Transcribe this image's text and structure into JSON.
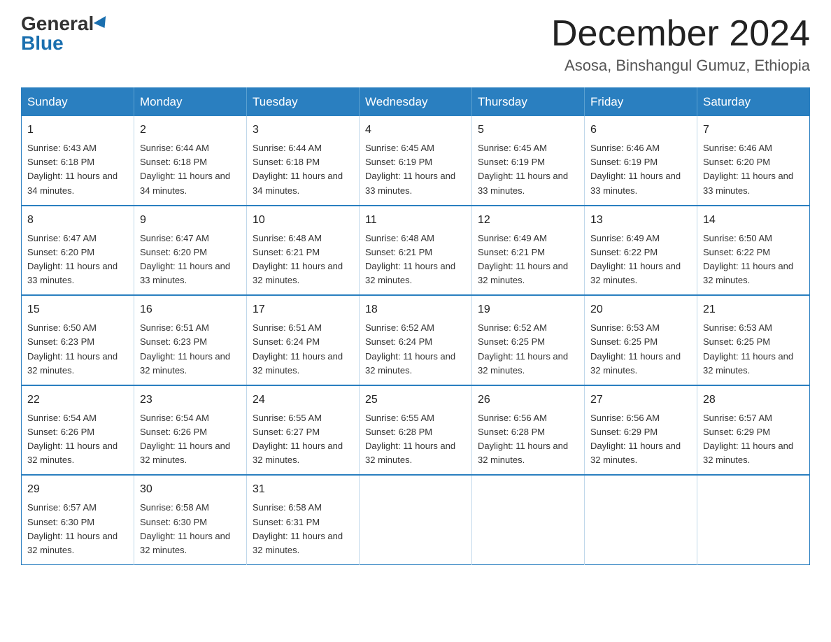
{
  "header": {
    "logo_general": "General",
    "logo_blue": "Blue",
    "month_year": "December 2024",
    "location": "Asosa, Binshangul Gumuz, Ethiopia"
  },
  "weekdays": [
    "Sunday",
    "Monday",
    "Tuesday",
    "Wednesday",
    "Thursday",
    "Friday",
    "Saturday"
  ],
  "weeks": [
    [
      {
        "day": "1",
        "sunrise": "6:43 AM",
        "sunset": "6:18 PM",
        "daylight": "11 hours and 34 minutes."
      },
      {
        "day": "2",
        "sunrise": "6:44 AM",
        "sunset": "6:18 PM",
        "daylight": "11 hours and 34 minutes."
      },
      {
        "day": "3",
        "sunrise": "6:44 AM",
        "sunset": "6:18 PM",
        "daylight": "11 hours and 34 minutes."
      },
      {
        "day": "4",
        "sunrise": "6:45 AM",
        "sunset": "6:19 PM",
        "daylight": "11 hours and 33 minutes."
      },
      {
        "day": "5",
        "sunrise": "6:45 AM",
        "sunset": "6:19 PM",
        "daylight": "11 hours and 33 minutes."
      },
      {
        "day": "6",
        "sunrise": "6:46 AM",
        "sunset": "6:19 PM",
        "daylight": "11 hours and 33 minutes."
      },
      {
        "day": "7",
        "sunrise": "6:46 AM",
        "sunset": "6:20 PM",
        "daylight": "11 hours and 33 minutes."
      }
    ],
    [
      {
        "day": "8",
        "sunrise": "6:47 AM",
        "sunset": "6:20 PM",
        "daylight": "11 hours and 33 minutes."
      },
      {
        "day": "9",
        "sunrise": "6:47 AM",
        "sunset": "6:20 PM",
        "daylight": "11 hours and 33 minutes."
      },
      {
        "day": "10",
        "sunrise": "6:48 AM",
        "sunset": "6:21 PM",
        "daylight": "11 hours and 32 minutes."
      },
      {
        "day": "11",
        "sunrise": "6:48 AM",
        "sunset": "6:21 PM",
        "daylight": "11 hours and 32 minutes."
      },
      {
        "day": "12",
        "sunrise": "6:49 AM",
        "sunset": "6:21 PM",
        "daylight": "11 hours and 32 minutes."
      },
      {
        "day": "13",
        "sunrise": "6:49 AM",
        "sunset": "6:22 PM",
        "daylight": "11 hours and 32 minutes."
      },
      {
        "day": "14",
        "sunrise": "6:50 AM",
        "sunset": "6:22 PM",
        "daylight": "11 hours and 32 minutes."
      }
    ],
    [
      {
        "day": "15",
        "sunrise": "6:50 AM",
        "sunset": "6:23 PM",
        "daylight": "11 hours and 32 minutes."
      },
      {
        "day": "16",
        "sunrise": "6:51 AM",
        "sunset": "6:23 PM",
        "daylight": "11 hours and 32 minutes."
      },
      {
        "day": "17",
        "sunrise": "6:51 AM",
        "sunset": "6:24 PM",
        "daylight": "11 hours and 32 minutes."
      },
      {
        "day": "18",
        "sunrise": "6:52 AM",
        "sunset": "6:24 PM",
        "daylight": "11 hours and 32 minutes."
      },
      {
        "day": "19",
        "sunrise": "6:52 AM",
        "sunset": "6:25 PM",
        "daylight": "11 hours and 32 minutes."
      },
      {
        "day": "20",
        "sunrise": "6:53 AM",
        "sunset": "6:25 PM",
        "daylight": "11 hours and 32 minutes."
      },
      {
        "day": "21",
        "sunrise": "6:53 AM",
        "sunset": "6:25 PM",
        "daylight": "11 hours and 32 minutes."
      }
    ],
    [
      {
        "day": "22",
        "sunrise": "6:54 AM",
        "sunset": "6:26 PM",
        "daylight": "11 hours and 32 minutes."
      },
      {
        "day": "23",
        "sunrise": "6:54 AM",
        "sunset": "6:26 PM",
        "daylight": "11 hours and 32 minutes."
      },
      {
        "day": "24",
        "sunrise": "6:55 AM",
        "sunset": "6:27 PM",
        "daylight": "11 hours and 32 minutes."
      },
      {
        "day": "25",
        "sunrise": "6:55 AM",
        "sunset": "6:28 PM",
        "daylight": "11 hours and 32 minutes."
      },
      {
        "day": "26",
        "sunrise": "6:56 AM",
        "sunset": "6:28 PM",
        "daylight": "11 hours and 32 minutes."
      },
      {
        "day": "27",
        "sunrise": "6:56 AM",
        "sunset": "6:29 PM",
        "daylight": "11 hours and 32 minutes."
      },
      {
        "day": "28",
        "sunrise": "6:57 AM",
        "sunset": "6:29 PM",
        "daylight": "11 hours and 32 minutes."
      }
    ],
    [
      {
        "day": "29",
        "sunrise": "6:57 AM",
        "sunset": "6:30 PM",
        "daylight": "11 hours and 32 minutes."
      },
      {
        "day": "30",
        "sunrise": "6:58 AM",
        "sunset": "6:30 PM",
        "daylight": "11 hours and 32 minutes."
      },
      {
        "day": "31",
        "sunrise": "6:58 AM",
        "sunset": "6:31 PM",
        "daylight": "11 hours and 32 minutes."
      },
      null,
      null,
      null,
      null
    ]
  ]
}
